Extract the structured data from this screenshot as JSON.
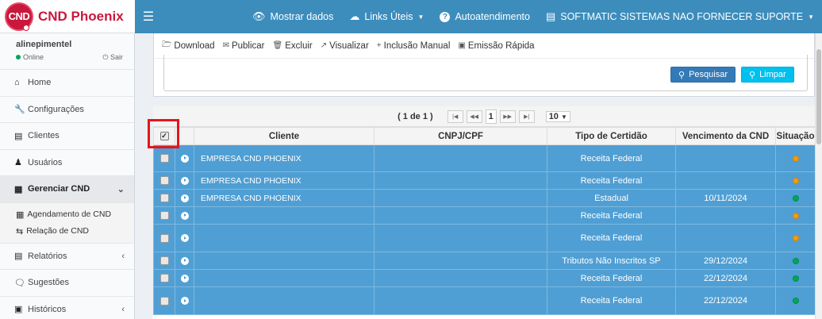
{
  "brand": {
    "badge": "CND",
    "name": "CND Phoenix"
  },
  "topnav": {
    "menu_icon": "hamburger-icon",
    "items": [
      {
        "label": "Mostrar dados",
        "icon": "eye-icon"
      },
      {
        "label": "Links Úteis",
        "icon": "cloud-icon"
      },
      {
        "label": "Autoatendimento",
        "icon": "help-icon"
      },
      {
        "label": "SOFTMATIC SISTEMAS NAO FORNECER SUPORTE",
        "icon": "building-icon"
      }
    ]
  },
  "user": {
    "name": "alinepimentel",
    "status": "Online",
    "logout": "Sair"
  },
  "sidebar": {
    "items": [
      {
        "label": "Home",
        "icon": "home-icon"
      },
      {
        "label": "Configurações",
        "icon": "wrench-icon"
      },
      {
        "label": "Clientes",
        "icon": "building-icon"
      },
      {
        "label": "Usuários",
        "icon": "user-icon"
      },
      {
        "label": "Gerenciar CND",
        "icon": "calendar-icon"
      },
      {
        "label": "Relatórios",
        "icon": "file-icon"
      },
      {
        "label": "Sugestões",
        "icon": "comments-icon"
      },
      {
        "label": "Históricos",
        "icon": "archive-icon"
      }
    ],
    "submenu": [
      {
        "label": "Agendamento de CND",
        "icon": "calendar-icon"
      },
      {
        "label": "Relação de CND",
        "icon": "exchange-icon"
      }
    ]
  },
  "actions": [
    {
      "label": "Download",
      "icon": "folder-open-icon"
    },
    {
      "label": "Publicar",
      "icon": "envelope-icon"
    },
    {
      "label": "Excluir",
      "icon": "trash-icon"
    },
    {
      "label": "Visualizar",
      "icon": "external-link-icon"
    },
    {
      "label": "Inclusão Manual",
      "icon": "plus-icon"
    },
    {
      "label": "Emissão Rápida",
      "icon": "save-icon"
    }
  ],
  "buttons": {
    "search": "Pesquisar",
    "clear": "Limpar"
  },
  "pager": {
    "count": "( 1 de 1 )",
    "current": "1",
    "per_page": "10"
  },
  "table": {
    "headers": [
      "",
      "",
      "Cliente",
      "CNPJ/CPF",
      "Tipo de Certidão",
      "Vencimento da CND",
      "Situação"
    ],
    "rows": [
      {
        "cliente": "EMPRESA CND PHOENIX",
        "cnpj": "",
        "tipo": "Receita Federal",
        "venc": "",
        "sit": "orange"
      },
      {
        "cliente": "EMPRESA CND PHOENIX",
        "cnpj": "",
        "tipo": "Receita Federal",
        "venc": "",
        "sit": "orange"
      },
      {
        "cliente": "EMPRESA CND PHOENIX",
        "cnpj": "",
        "tipo": "Estadual",
        "venc": "10/11/2024",
        "sit": "green"
      },
      {
        "cliente": "",
        "cnpj": "",
        "tipo": "Receita Federal",
        "venc": "",
        "sit": "orange"
      },
      {
        "cliente": "",
        "cnpj": "",
        "tipo": "Receita Federal",
        "venc": "",
        "sit": "orange"
      },
      {
        "cliente": "",
        "cnpj": "",
        "tipo": "Tributos Não Inscritos SP",
        "venc": "29/12/2024",
        "sit": "green"
      },
      {
        "cliente": "",
        "cnpj": "",
        "tipo": "Receita Federal",
        "venc": "22/12/2024",
        "sit": "green"
      },
      {
        "cliente": "",
        "cnpj": "",
        "tipo": "Receita Federal",
        "venc": "22/12/2024",
        "sit": "green"
      }
    ]
  },
  "colors": {
    "topbar": "#3c8dbc",
    "row": "#4f9fd4",
    "brand": "#c9183c",
    "highlight": "#e8141b"
  }
}
